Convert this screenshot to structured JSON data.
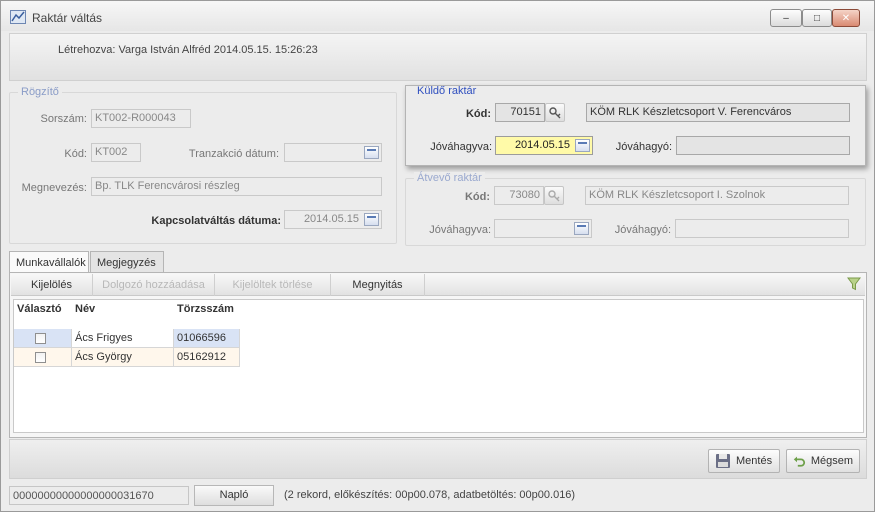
{
  "window": {
    "title": "Raktár váltás",
    "minimize_label": "‒",
    "maximize_label": "□",
    "close_label": "✕"
  },
  "info": {
    "created_text": "Létrehozva: Varga István Alfréd 2014.05.15. 15:26:23"
  },
  "rogzito": {
    "legend": "Rögzítő",
    "sorszam_label": "Sorszám:",
    "sorszam_value": "KT002-R000043",
    "kod_label": "Kód:",
    "kod_value": "KT002",
    "tranzakcio_label": "Tranzakció dátum:",
    "tranzakcio_value": "",
    "megnevezes_label": "Megnevezés:",
    "megnevezes_value": "Bp. TLK Ferencvárosi részleg",
    "kapcsolat_label": "Kapcsolatváltás dátuma:",
    "kapcsolat_value": "2014.05.15"
  },
  "kuldo": {
    "legend": "Küldő raktár",
    "kod_label": "Kód:",
    "kod_value": "70151",
    "name_value": "KÖM RLK Készletcsoport V. Ferencváros",
    "jovahagyva_label": "Jóváhagyva:",
    "jovahagyva_value": "2014.05.15",
    "jovahagyo_label": "Jóváhagyó:",
    "jovahagyo_value": ""
  },
  "atvevo": {
    "legend": "Átvevő raktár",
    "kod_label": "Kód:",
    "kod_value": "73080",
    "name_value": "KÖM RLK Készletcsoport I. Szolnok",
    "jovahagyva_label": "Jóváhagyva:",
    "jovahagyva_value": "",
    "jovahagyo_label": "Jóváhagyó:",
    "jovahagyo_value": ""
  },
  "tabs": [
    {
      "label": "Munkavállalók",
      "active": true
    },
    {
      "label": "Megjegyzés",
      "active": false
    }
  ],
  "toolbar": {
    "kijeloles": "Kijelölés",
    "dolgozo_hozzaadasa": "Dolgozó hozzáadása",
    "kijeloltek_torlese": "Kijelöltek törlése",
    "megnyitas": "Megnyitás"
  },
  "grid": {
    "columns": [
      "Választó",
      "Név",
      "Törzsszám"
    ],
    "rows": [
      {
        "selected": false,
        "name": "Ács Frigyes",
        "id": "01066596"
      },
      {
        "selected": false,
        "name": "Ács György",
        "id": "05162912"
      }
    ]
  },
  "actions": {
    "save_label": "Mentés",
    "cancel_label": "Mégsem"
  },
  "status": {
    "code": "00000000000000000031670",
    "naplo_label": "Napló",
    "message": "(2 rekord, előkészítés: 00p00.078, adatbetöltés: 00p00.016)"
  },
  "colors": {
    "accent": "#2f4fbf",
    "highlight_field": "#fffaa8",
    "selected_row": "#d9e3f5"
  }
}
